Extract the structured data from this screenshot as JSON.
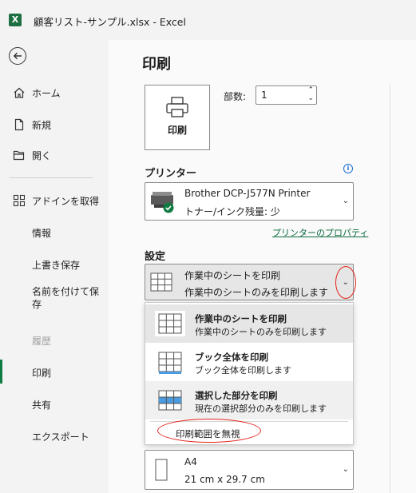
{
  "window": {
    "title": "顧客リスト-サンプル.xlsx  -  Excel",
    "app_logo": "X"
  },
  "nav": {
    "items": [
      {
        "label": "ホーム",
        "icon": "home-icon"
      },
      {
        "label": "新規",
        "icon": "new-document-icon"
      },
      {
        "label": "開く",
        "icon": "open-folder-icon"
      },
      {
        "label": "アドインを取得",
        "icon": "add-ins-icon"
      },
      {
        "label": "情報"
      },
      {
        "label": "上書き保存"
      },
      {
        "label": "名前を付けて保存"
      },
      {
        "label": "履歴"
      },
      {
        "label": "印刷"
      },
      {
        "label": "共有"
      },
      {
        "label": "エクスポート"
      }
    ],
    "selected": "印刷",
    "accent": "#107c41"
  },
  "main": {
    "title": "印刷",
    "print_button": "印刷",
    "copies_label": "部数:",
    "copies_value": "1",
    "printer_heading": "プリンター",
    "printer": {
      "name": "Brother DCP-J577N Printer",
      "status": "トナー/インク残量: 少"
    },
    "printer_props_link": "プリンターのプロパティ",
    "settings_heading": "設定",
    "setting_selected": {
      "title": "作業中のシートを印刷",
      "desc": "作業中のシートのみを印刷します"
    },
    "dropdown": {
      "options": [
        {
          "title": "作業中のシートを印刷",
          "desc": "作業中のシートのみを印刷します"
        },
        {
          "title": "ブック全体を印刷",
          "desc": "ブック全体を印刷します"
        },
        {
          "title": "選択した部分を印刷",
          "desc": "現在の選択部分のみを印刷します"
        }
      ],
      "ignore_print_area": "印刷範囲を無視"
    },
    "paper": {
      "size": "A4",
      "dims": "21 cm x 29.7 cm"
    }
  },
  "colors": {
    "highlight": "#e2231a",
    "link": "#0a6a3c",
    "info": "#1a6fd1",
    "selected_cell": "#4a9be0"
  }
}
